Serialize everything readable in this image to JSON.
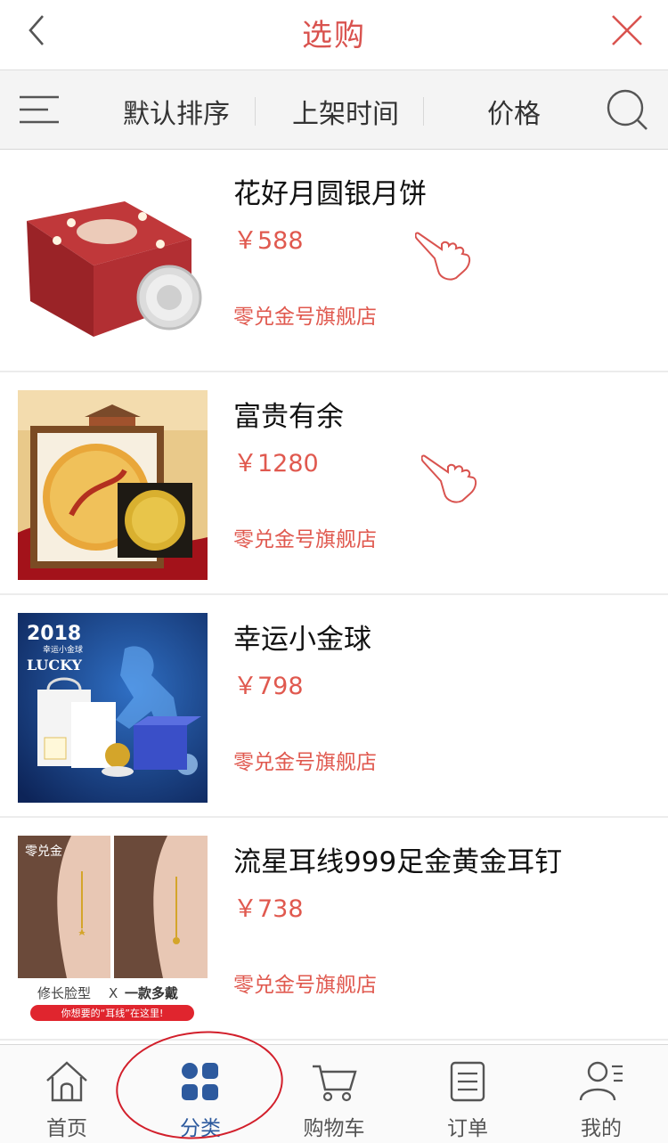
{
  "header": {
    "title": "选购",
    "back_icon": "chevron-left-icon",
    "close_icon": "close-icon",
    "accent_color": "#d9534f"
  },
  "sortbar": {
    "menu_icon": "menu-icon",
    "options": [
      {
        "label": "默认排序"
      },
      {
        "label": "上架时间"
      },
      {
        "label": "价格"
      }
    ],
    "search_icon": "search-icon"
  },
  "products": [
    {
      "name": "花好月圆银月饼",
      "price": "￥588",
      "shop": "零兑金号旗舰店",
      "image": "red-gift-box-silver-mooncake-image",
      "pointer": true
    },
    {
      "name": "富贵有余",
      "price": "￥1280",
      "shop": "零兑金号旗舰店",
      "image": "framed-goldfish-gold-coin-image",
      "pointer": true
    },
    {
      "name": "幸运小金球",
      "price": "￥798",
      "shop": "零兑金号旗舰店",
      "image": "lucky-gold-ball-football-image",
      "image_text": [
        "2018",
        "幸运小金球",
        "LUCKY"
      ],
      "pointer": false
    },
    {
      "name": "流星耳线999足金黄金耳钉",
      "price": "￥738",
      "shop": "零兑金号旗舰店",
      "image": "gold-earring-model-image",
      "image_text": [
        "零兑金",
        "修长脸型",
        "X",
        "一款多戴",
        "你想要的“耳线”在这里!"
      ],
      "pointer": false
    }
  ],
  "tabbar": {
    "items": [
      {
        "label": "首页",
        "icon": "home-icon"
      },
      {
        "label": "分类",
        "icon": "category-grid-icon",
        "active": true
      },
      {
        "label": "购物车",
        "icon": "cart-icon"
      },
      {
        "label": "订单",
        "icon": "order-list-icon"
      },
      {
        "label": "我的",
        "icon": "user-icon"
      }
    ],
    "active_color": "#2d5a9e"
  }
}
